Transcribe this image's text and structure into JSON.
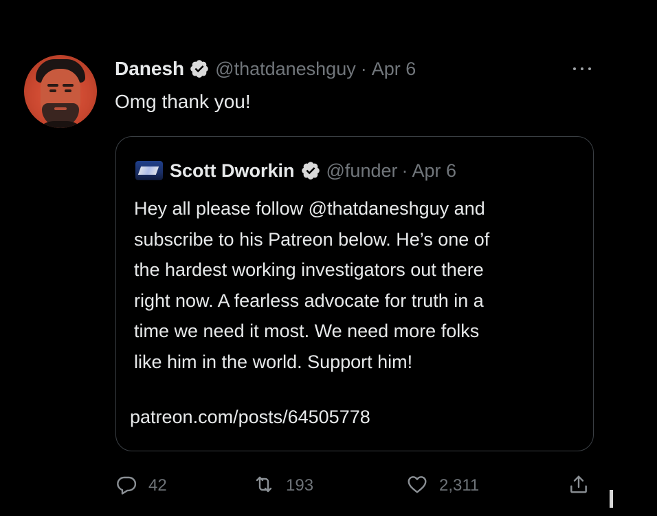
{
  "colors": {
    "background": "#000000",
    "primary_text": "#e7e9ea",
    "secondary_text": "#71767b",
    "border": "#3a3f44"
  },
  "tweet": {
    "author": {
      "name": "Danesh",
      "handle": "@thatdaneshguy",
      "separator": "·",
      "date": "Apr 6",
      "verified_icon": "verified-badge-icon",
      "avatar_icon": "profile-photo"
    },
    "text": "Omg thank you!",
    "more_icon": "more-options-icon"
  },
  "quote": {
    "author": {
      "name": "Scott Dworkin",
      "handle": "@funder",
      "separator": "·",
      "date": "Apr 6",
      "verified_icon": "verified-badge-icon"
    },
    "lines": [
      "Hey all please follow @thatdaneshguy and",
      "subscribe to his Patreon below. He’s one of",
      "the hardest working investigators out there",
      "right now. A fearless advocate for truth in a",
      "time we need it most. We need more folks",
      "like him in the world. Support him!"
    ],
    "link": "patreon.com/posts/64505778"
  },
  "actions": {
    "reply": {
      "icon": "reply-icon",
      "count": "42"
    },
    "retweet": {
      "icon": "retweet-icon",
      "count": "193"
    },
    "like": {
      "icon": "heart-icon",
      "count": "2,311"
    },
    "share": {
      "icon": "share-icon"
    }
  }
}
